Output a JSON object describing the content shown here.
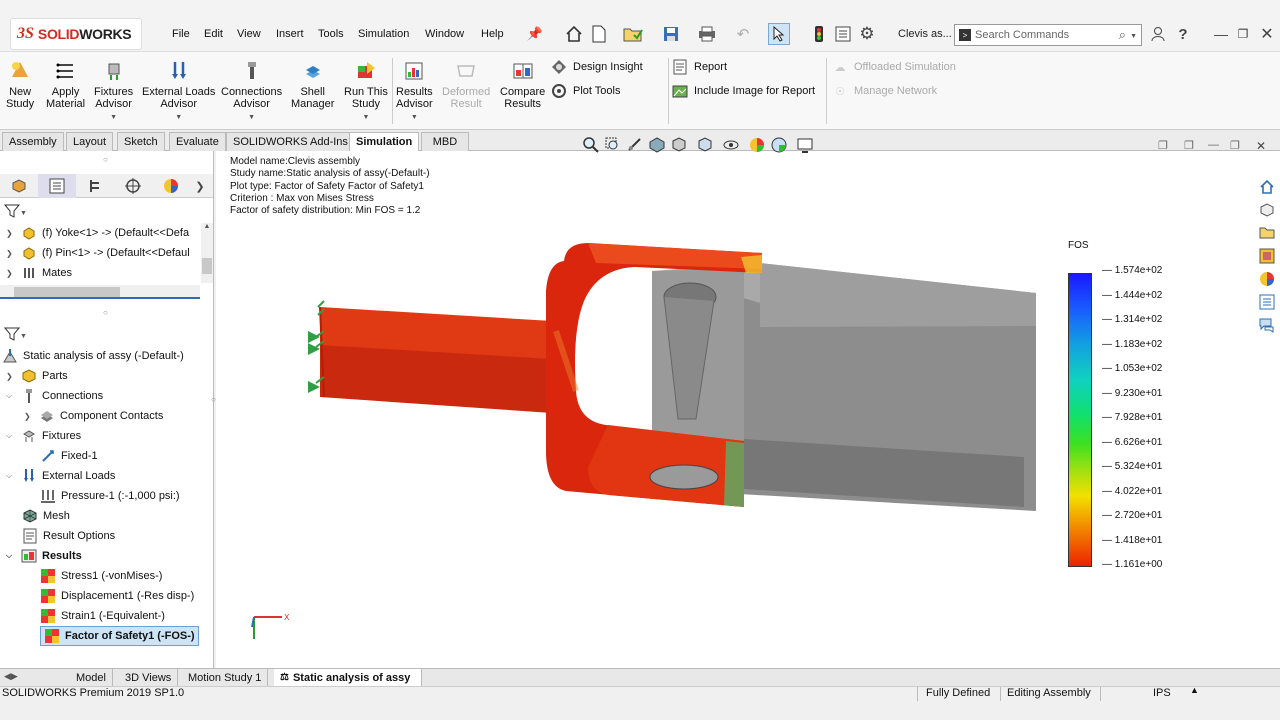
{
  "brand": {
    "logo_ds": "3S",
    "logo_text_red": "SOLID",
    "logo_text_dark": "WORKS"
  },
  "menu": [
    "File",
    "Edit",
    "View",
    "Insert",
    "Tools",
    "Simulation",
    "Window",
    "Help"
  ],
  "doc_title": "Clevis as...",
  "search": {
    "placeholder": "Search Commands"
  },
  "ribbon": {
    "new_study": [
      "New",
      "Study"
    ],
    "apply_material": [
      "Apply",
      "Material"
    ],
    "fixtures_advisor": [
      "Fixtures",
      "Advisor"
    ],
    "external_loads_advisor": [
      "External Loads",
      "Advisor"
    ],
    "connections_advisor": [
      "Connections",
      "Advisor"
    ],
    "shell_manager": [
      "Shell",
      "Manager"
    ],
    "run_this_study": [
      "Run This",
      "Study"
    ],
    "results_advisor": [
      "Results",
      "Advisor"
    ],
    "deformed_result": [
      "Deformed",
      "Result"
    ],
    "compare_results": [
      "Compare",
      "Results"
    ],
    "design_insight": "Design Insight",
    "plot_tools": "Plot Tools",
    "report": "Report",
    "include_image": "Include Image for Report",
    "offloaded_simulation": "Offloaded Simulation",
    "manage_network": "Manage Network"
  },
  "command_tabs": [
    "Assembly",
    "Layout",
    "Sketch",
    "Evaluate",
    "SOLIDWORKS Add-Ins",
    "Simulation",
    "MBD"
  ],
  "active_command_tab": "Simulation",
  "feature_tree": {
    "items": [
      "(f) Yoke<1> -> (Default<<Defa",
      "(f) Pin<1> -> (Default<<Defaul",
      "Mates"
    ]
  },
  "sim_tree": {
    "study": "Static  analysis of assy (-Default-)",
    "parts": "Parts",
    "connections": "Connections",
    "component_contacts": "Component Contacts",
    "fixtures": "Fixtures",
    "fixed": "Fixed-1",
    "external_loads": "External Loads",
    "pressure": "Pressure-1 (:-1,000 psi:)",
    "mesh": "Mesh",
    "result_options": "Result Options",
    "results": "Results",
    "stress": "Stress1 (-vonMises-)",
    "displacement": "Displacement1 (-Res disp-)",
    "strain": "Strain1 (-Equivalent-)",
    "fos": "Factor of Safety1 (-FOS-)"
  },
  "plot_info": [
    "Model name:Clevis assembly",
    "Study name:Static  analysis of assy(-Default-)",
    "Plot type: Factor of Safety Factor of Safety1",
    "Criterion : Max von Mises Stress",
    "Factor of safety distribution: Min FOS = 1.2"
  ],
  "legend": {
    "title": "FOS",
    "labels": [
      "1.574e+02",
      "1.444e+02",
      "1.314e+02",
      "1.183e+02",
      "1.053e+02",
      "9.230e+01",
      "7.928e+01",
      "6.626e+01",
      "5.324e+01",
      "4.022e+01",
      "2.720e+01",
      "1.418e+01",
      "1.161e+00"
    ]
  },
  "bottom_tabs": [
    "Model",
    "3D Views",
    "Motion Study 1",
    "Static  analysis of assy"
  ],
  "active_bottom_tab": "Static  analysis of assy",
  "status": {
    "product": "SOLIDWORKS Premium 2019 SP1.0",
    "defined": "Fully Defined",
    "mode": "Editing Assembly",
    "units": "IPS"
  },
  "icons": [
    "home-icon",
    "new-doc-icon",
    "open-icon",
    "save-icon",
    "print-icon",
    "undo-icon",
    "select-icon",
    "traffic-light-icon",
    "options-icon",
    "user-icon",
    "help-icon"
  ]
}
